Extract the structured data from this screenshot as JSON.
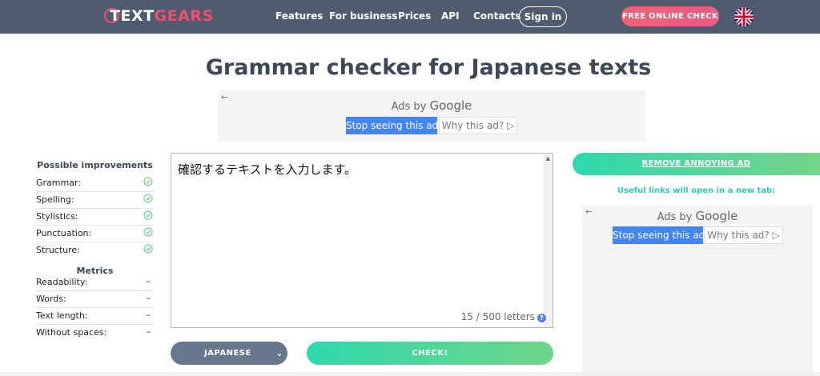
{
  "header": {
    "logo_part1": "TEXT",
    "logo_part2": "GEARS",
    "nav": [
      "Features",
      "For business",
      "Prices",
      "API",
      "Contacts"
    ],
    "sign_in": "Sign in",
    "cta": "FREE ONLINE CHECK",
    "language_flag_icon": "uk-flag-icon"
  },
  "page": {
    "title": "Grammar checker for Japanese texts"
  },
  "ads": {
    "back_arrow": "←",
    "ads_by": "Ads by",
    "google": "Google",
    "stop_seeing": "Stop seeing this ad",
    "why_this_ad": "Why this ad? ▷"
  },
  "improvements": {
    "heading": "Possible improvements",
    "items": [
      "Grammar:",
      "Spelling:",
      "Stylistics:",
      "Punctuation:",
      "Structure:"
    ]
  },
  "metrics": {
    "heading": "Metrics",
    "items": [
      {
        "label": "Readability:",
        "value": "–"
      },
      {
        "label": "Words:",
        "value": "–"
      },
      {
        "label": "Text length:",
        "value": "–"
      },
      {
        "label": "Without spaces:",
        "value": "–"
      }
    ]
  },
  "editor": {
    "text": "確認するテキストを入力します。",
    "letters": "15 / 500 letters",
    "help": "?",
    "scroll_up": "▲"
  },
  "controls": {
    "language": "JAPANESE",
    "chevron": "⌄",
    "check": "CHECK!"
  },
  "right_panel": {
    "remove_ad": "REMOVE ANNOYING AD",
    "useful_links": "Useful links will open in a new tab:"
  },
  "colors": {
    "header_bg": "#4f5b6e",
    "accent_pink": "#f0506e",
    "accent_green": "#2ed8ae",
    "check_icon": "#5cc87a"
  }
}
